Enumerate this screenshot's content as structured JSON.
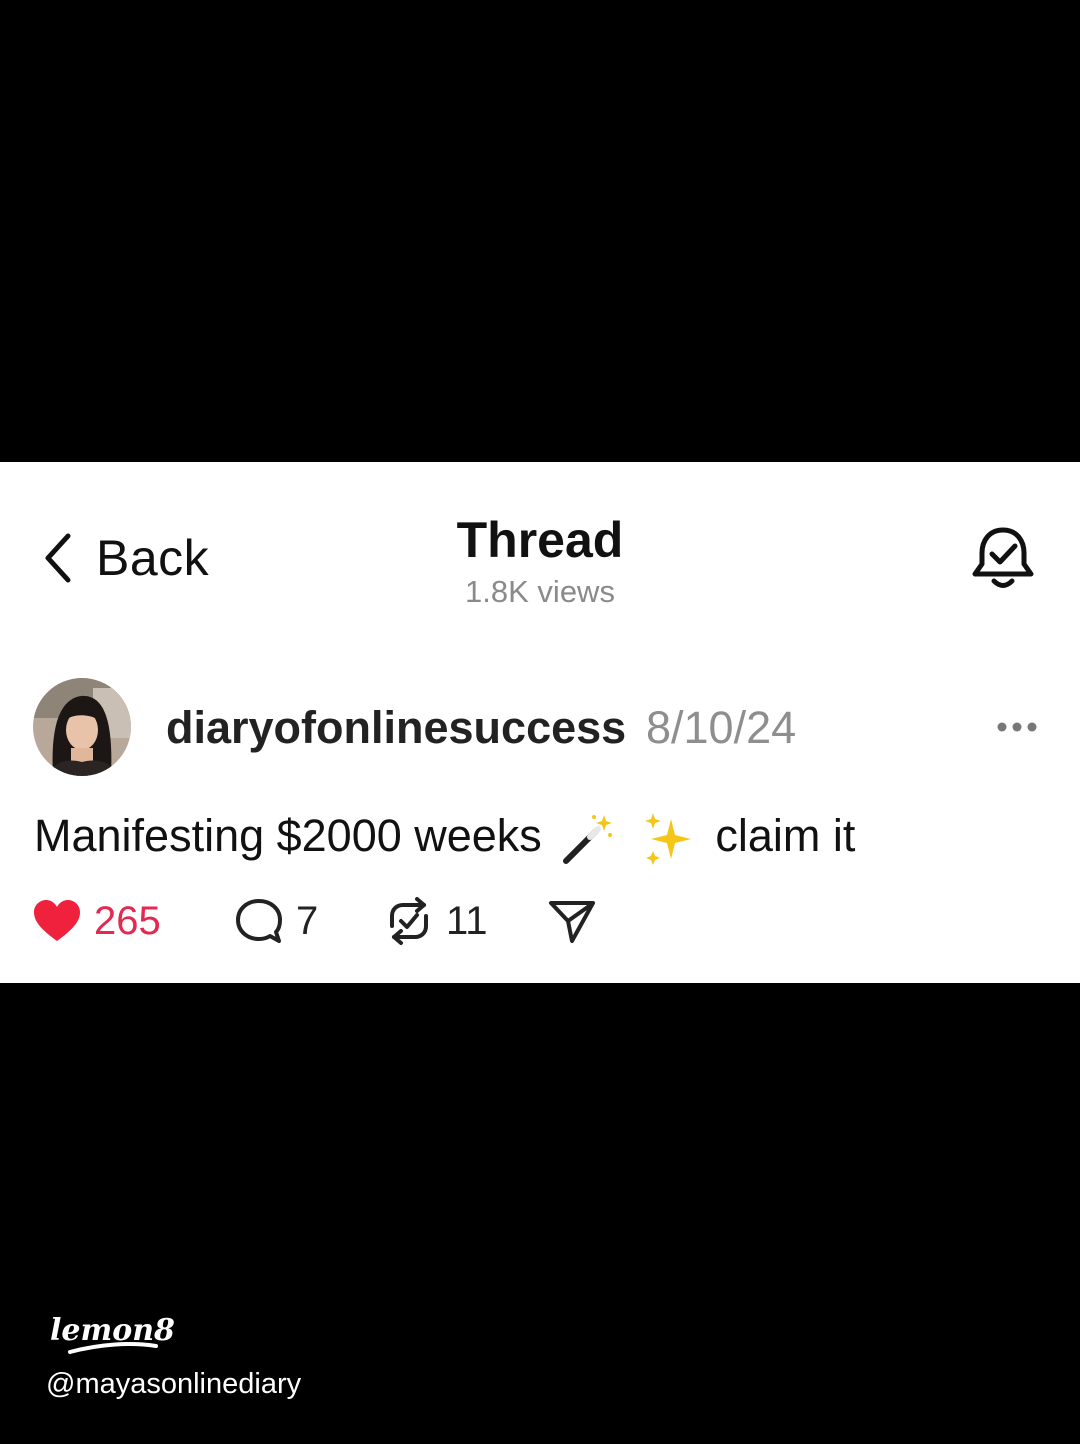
{
  "header": {
    "back_label": "Back",
    "title": "Thread",
    "views": "1.8K views",
    "bell_icon": "bell-check-icon"
  },
  "post": {
    "username": "diaryofonlinesuccess",
    "date": "8/10/24",
    "text_before": "Manifesting $2000 weeks",
    "emojis": [
      "magic-wand-emoji",
      "sparkles-emoji"
    ],
    "text_after": "claim it",
    "more_icon": "more-horizontal-icon"
  },
  "actions": {
    "likes": "265",
    "comments": "7",
    "reposts": "11",
    "liked": true,
    "like_color": "#e5284f"
  },
  "watermark": {
    "brand": "lemon8",
    "handle": "@mayasonlinediary"
  }
}
